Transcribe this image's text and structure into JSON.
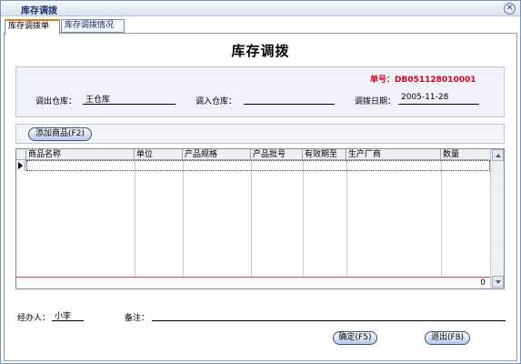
{
  "window": {
    "title": "库存调拨",
    "close_glyph": "✕"
  },
  "tabs": [
    {
      "label": "库存调拨单",
      "active": true
    },
    {
      "label": "库存调拨情况",
      "active": false
    }
  ],
  "form": {
    "title": "库存调拨",
    "doc_no_label": "单号：",
    "doc_no": "DB051128010001",
    "from_wh_label": "调出仓库：",
    "from_wh": "王仓库",
    "to_wh_label": "调入仓库：",
    "to_wh": "",
    "date_label": "调拨日期：",
    "date": "2005-11-28"
  },
  "toolbar": {
    "add_label": "添加商品(F2)"
  },
  "grid": {
    "columns": [
      "商品名称",
      "单位",
      "产品规格",
      "产品批号",
      "有效期至",
      "生产厂商",
      "数量"
    ],
    "rows": [],
    "total_qty": "0"
  },
  "bottom": {
    "handler_label": "经办人：",
    "handler": "小李",
    "remark_label": "备注：",
    "remark": "",
    "ok_label": "确定(F5)",
    "exit_label": "退出(F8)"
  },
  "colors": {
    "doc_no": "#d0021b",
    "tab_accent": "#e37b26",
    "header_bg": "#f1f2fb"
  },
  "icons": {
    "close": "close-icon",
    "row_pointer": "row-pointer-icon"
  }
}
